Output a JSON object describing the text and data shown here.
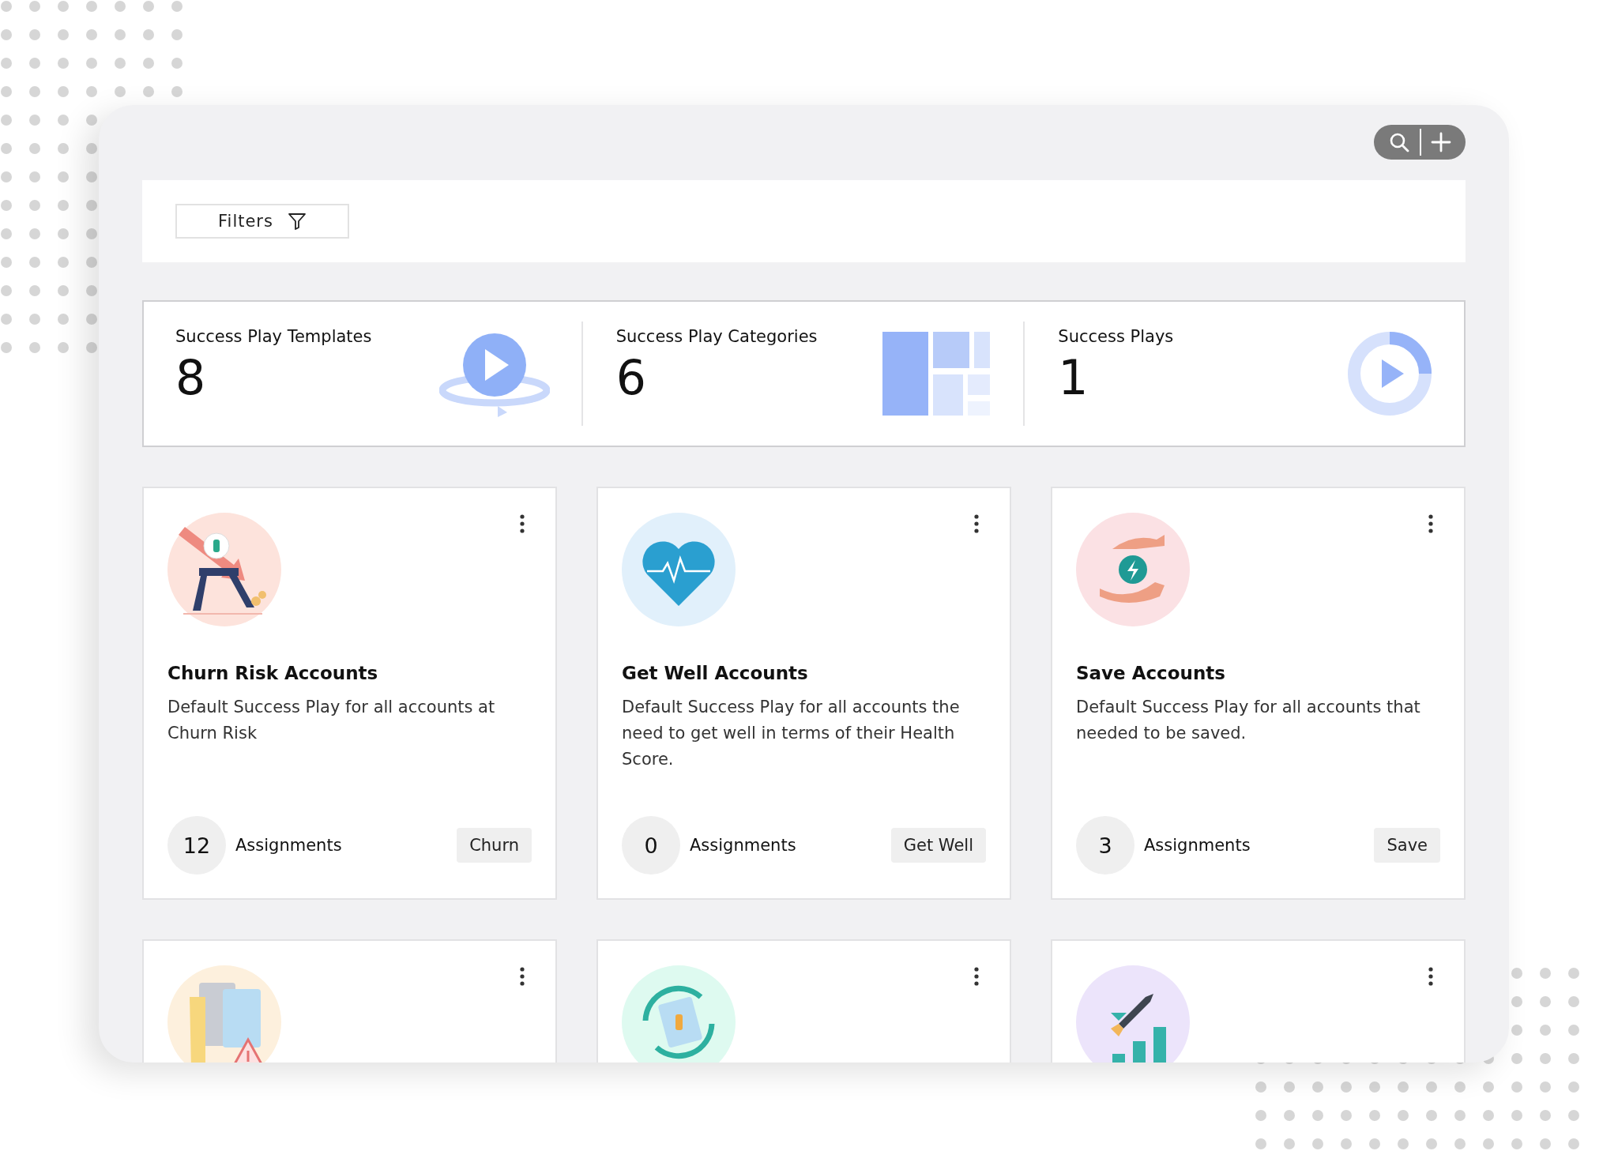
{
  "toolbar": {
    "buttons": [
      {
        "kind": "search"
      },
      {
        "kind": "add"
      }
    ]
  },
  "filter_bar": {
    "button": "Filters"
  },
  "stats": [
    {
      "label": "Success Play Templates",
      "value": "8",
      "kind": "templates"
    },
    {
      "label": "Success Play Categories",
      "value": "6",
      "kind": "categories"
    },
    {
      "label": "Success Plays",
      "value": "1",
      "kind": "plays"
    }
  ],
  "cards": [
    {
      "kind": "churn",
      "title": "Churn Risk Accounts",
      "description": "Default Success Play for all accounts at Churn Risk",
      "count": "12",
      "count_label": "Assignments",
      "tag": "Churn"
    },
    {
      "kind": "heart",
      "title": "Get Well Accounts",
      "description": "Default Success Play for all accounts the need to get well in terms of their Health Score.",
      "count": "0",
      "count_label": "Assignments",
      "tag": "Get Well"
    },
    {
      "kind": "hands",
      "title": "Save Accounts",
      "description": "Default Success Play for all accounts that needed to be saved.",
      "count": "3",
      "count_label": "Assignments",
      "tag": "Save"
    },
    {
      "kind": "folders"
    },
    {
      "kind": "renewal"
    },
    {
      "kind": "rocket"
    }
  ]
}
